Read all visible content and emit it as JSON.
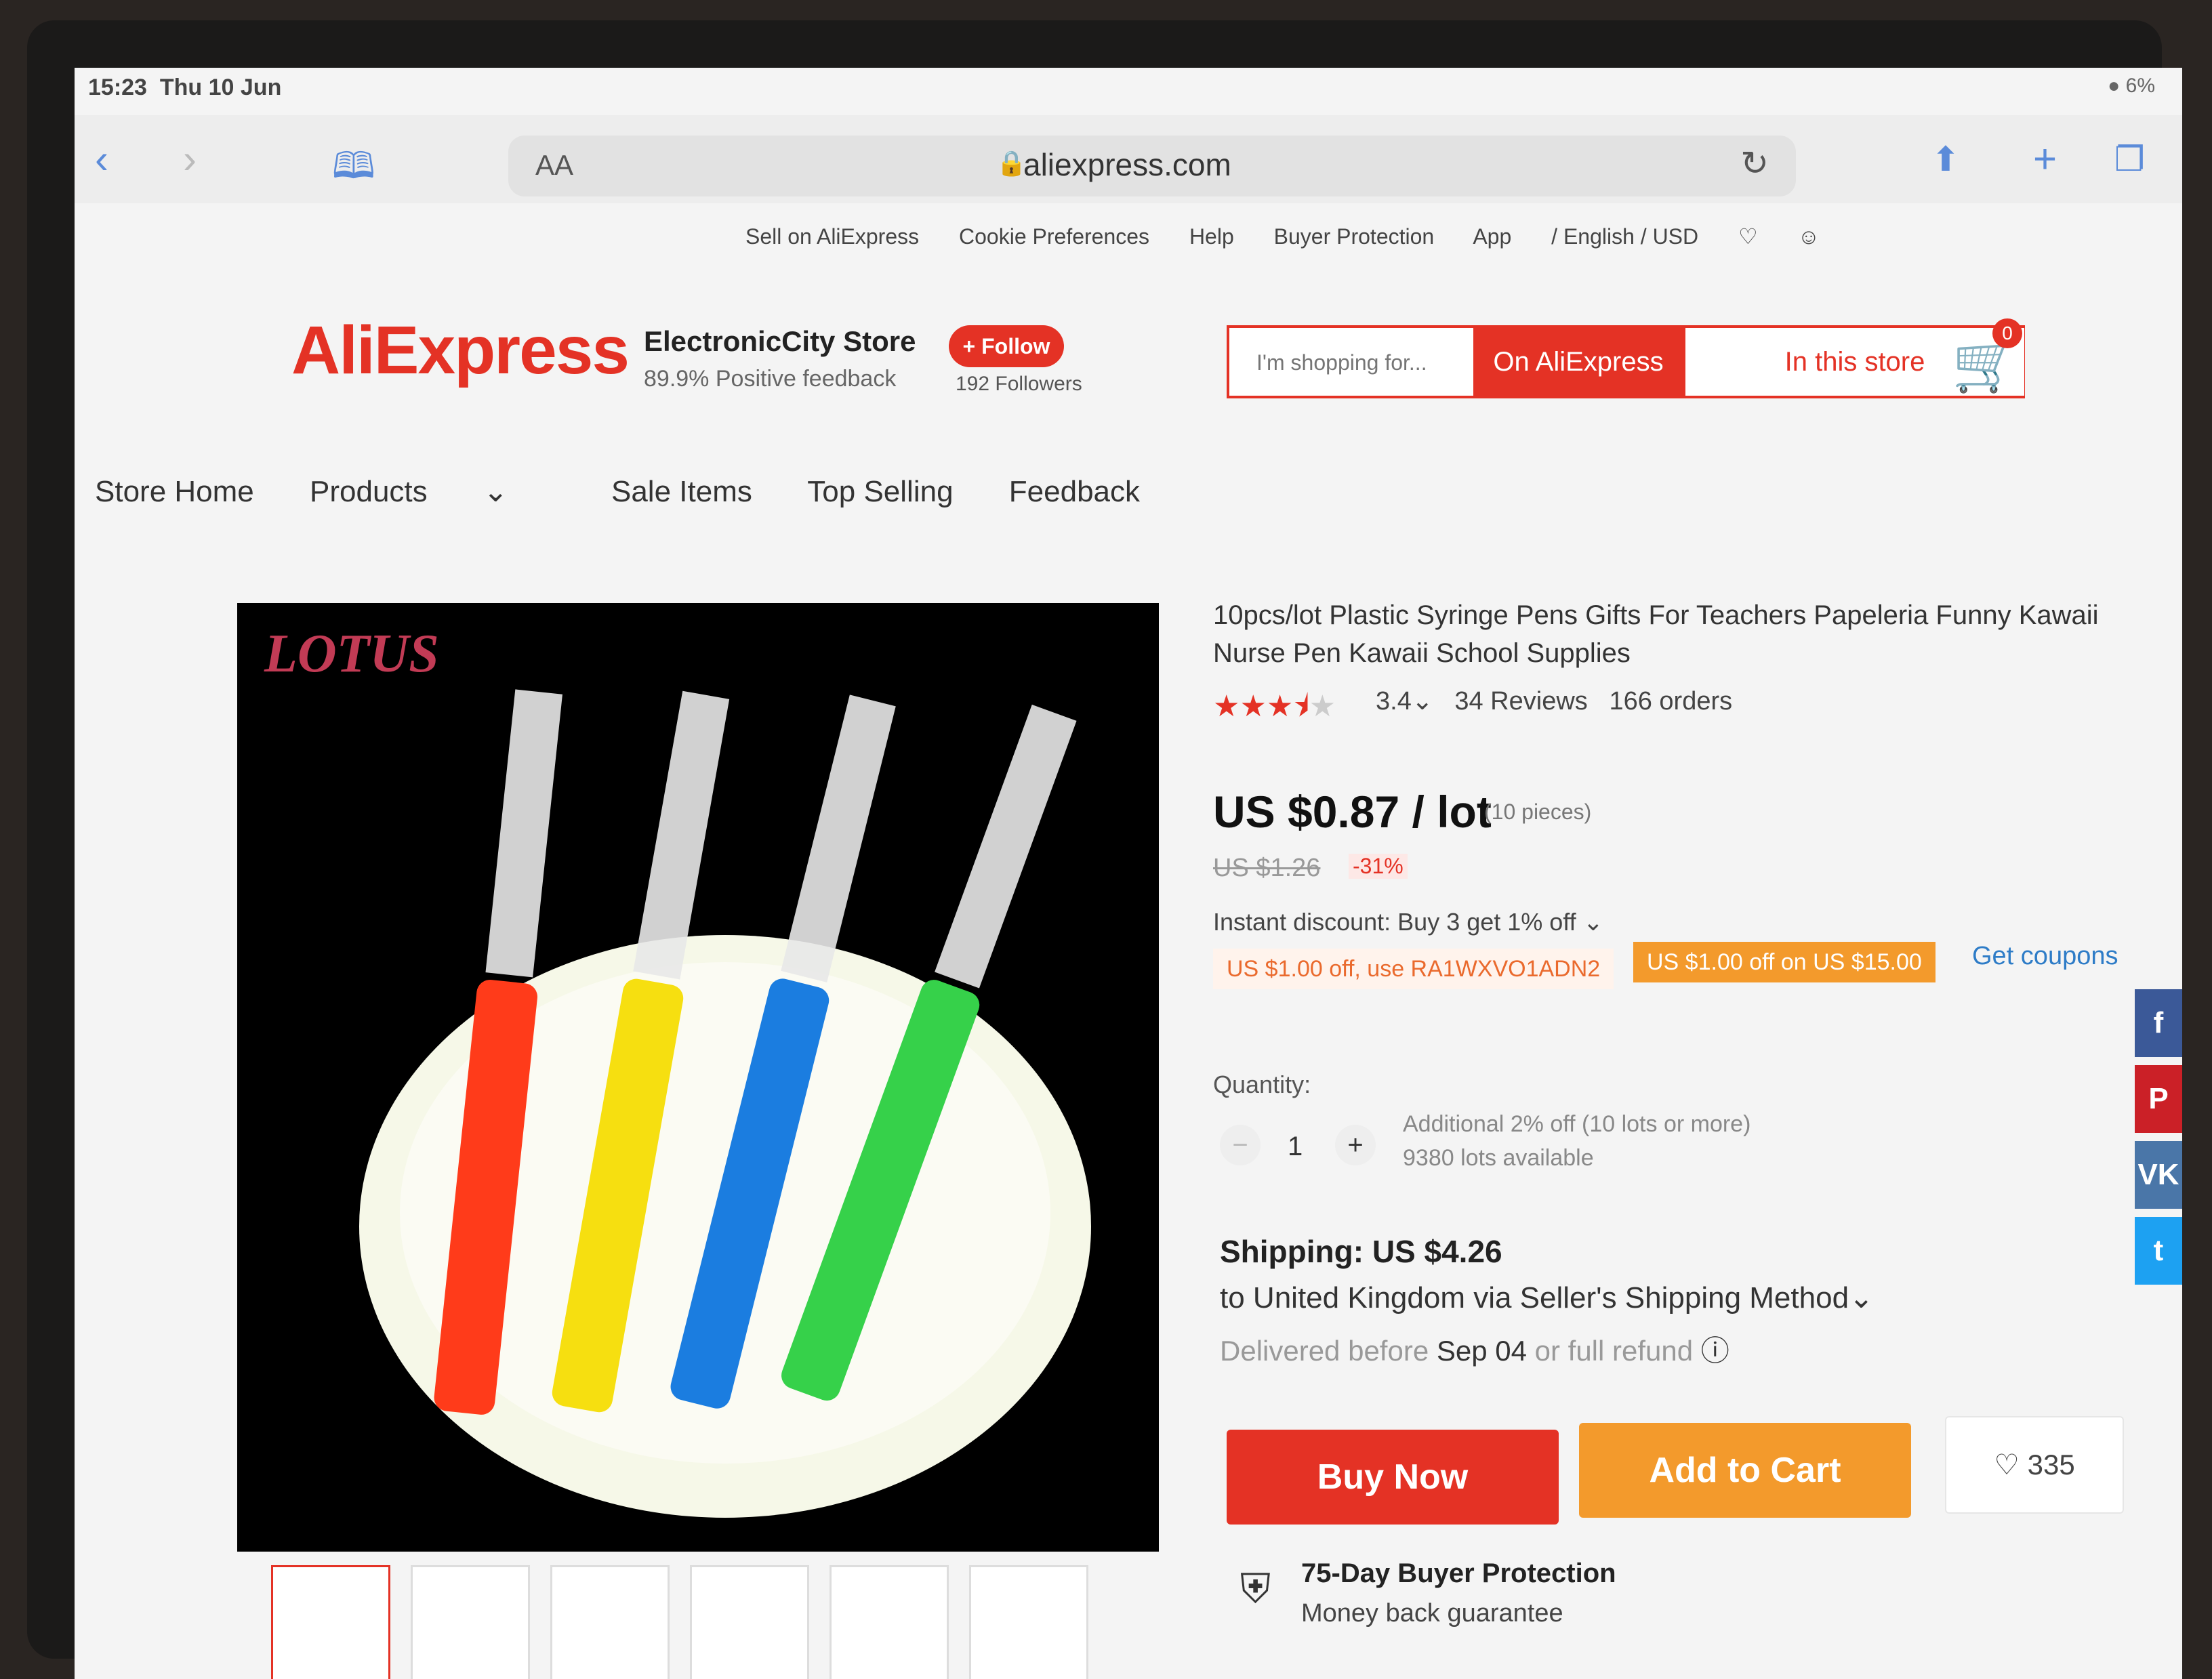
{
  "status": {
    "time": "15:23",
    "date": "Thu 10 Jun",
    "battery": "6%"
  },
  "browser": {
    "reader_label": "AA",
    "url": "aliexpress.com"
  },
  "top_nav": {
    "items": [
      "Sell on AliExpress",
      "Cookie Preferences",
      "Help",
      "Buyer Protection",
      "App",
      "/ English / USD"
    ]
  },
  "header": {
    "logo": "AliExpress",
    "store_name": "ElectronicCity Store",
    "positive_feedback": "89.9% Positive feedback",
    "follow_label": "+ Follow",
    "followers": "192 Followers",
    "search_placeholder": "I'm shopping for...",
    "search_on_ali": "On AliExpress",
    "search_in_store": "In this store",
    "cart_count": "0"
  },
  "store_nav": {
    "items": [
      "Store Home",
      "Products",
      "Sale Items",
      "Top Selling",
      "Feedback"
    ]
  },
  "product": {
    "brand": "LOTUS",
    "title": "10pcs/lot Plastic Syringe Pens Gifts For Teachers Papeleria Funny Kawaii Nurse Pen Kawaii School Supplies",
    "rating": "3.4",
    "reviews": "34 Reviews",
    "orders": "166 orders",
    "price": "US $0.87 / lot",
    "pieces": "(10 pieces)",
    "old_price": "US $1.26",
    "discount": "-31%",
    "instant_discount": "Instant discount: Buy 3 get 1% off",
    "coupon_code": "US $1.00 off, use RA1WXVO1ADN2",
    "coupon_threshold": "US $1.00 off on US $15.00",
    "get_coupons": "Get coupons",
    "quantity_label": "Quantity:",
    "quantity": "1",
    "quantity_discount": "Additional 2% off (10 lots or more)",
    "available": "9380 lots available",
    "shipping": "Shipping: US $4.26",
    "ship_to": "to United Kingdom via Seller's Shipping Method",
    "delivery_prefix": "Delivered before",
    "delivery_date": "Sep 04",
    "delivery_suffix": "or full refund",
    "buy_now": "Buy Now",
    "add_to_cart": "Add to Cart",
    "wishlist_count": "335",
    "protection_title": "75-Day Buyer Protection",
    "protection_sub": "Money back guarantee"
  },
  "colors": {
    "accent": "#e43225",
    "orange": "#f39a2c",
    "link": "#2e7cc7"
  }
}
